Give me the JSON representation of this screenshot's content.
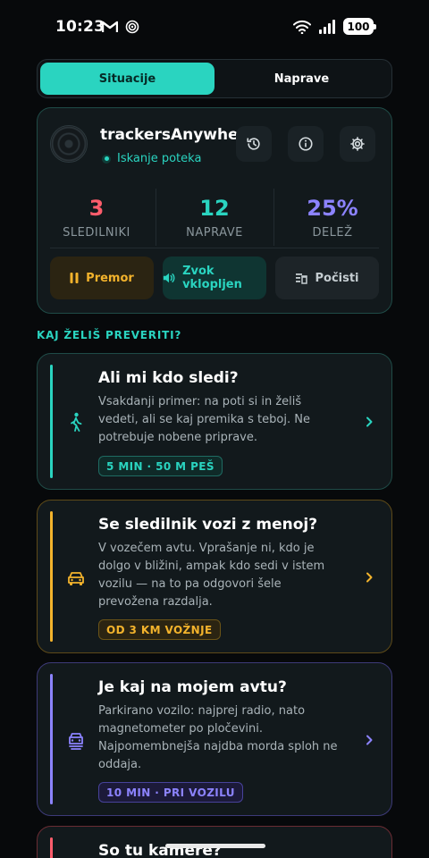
{
  "status_bar": {
    "time": "10:23",
    "battery": "100"
  },
  "tabs": [
    {
      "label": "Situacije",
      "active": true
    },
    {
      "label": "Naprave",
      "active": false
    }
  ],
  "main_card": {
    "app_name": "trackersAnywhere",
    "status": "Iskanje poteka",
    "stats": [
      {
        "value": "3",
        "label": "SLEDILNIKI",
        "color": "#ff5d6c"
      },
      {
        "value": "12",
        "label": "NAPRAVE",
        "color": "#2ad4c0"
      },
      {
        "value": "25%",
        "label": "DELEŽ",
        "color": "#8c83ff"
      }
    ],
    "actions": {
      "pause": "Premor",
      "sound": "Zvok vklopljen",
      "clear": "Počisti"
    }
  },
  "section_label": "KAJ ŽELIŠ PREVERITI?",
  "scenarios": [
    {
      "title": "Ali mi kdo sledi?",
      "description": "Vsakdanji primer: na poti si in želiš vedeti, ali se kaj premika s teboj. Ne potrebuje nobene priprave.",
      "tag": "5 MIN · 50 M PEŠ",
      "accent": "#2ad4c0",
      "icon": "walking-icon"
    },
    {
      "title": "Se sledilnik vozi z menoj?",
      "description": "V vozečem avtu. Vprašanje ni, kdo je dolgo v bližini, ampak kdo sedi v istem vozilu — na to pa odgovori šele prevožena razdalja.",
      "tag": "OD 3 KM VOŽNJE",
      "accent": "#f3b32c",
      "icon": "car-icon"
    },
    {
      "title": "Je kaj na mojem avtu?",
      "description": "Parkirano vozilo: najprej radio, nato magnetometer po pločevini. Najpomembnejša najdba morda sploh ne oddaja.",
      "tag": "10 MIN · PRI VOZILU",
      "accent": "#8c83ff",
      "icon": "parked-car-icon"
    },
    {
      "title": "So tu kamere?",
      "accent": "#ff5d6c"
    }
  ]
}
